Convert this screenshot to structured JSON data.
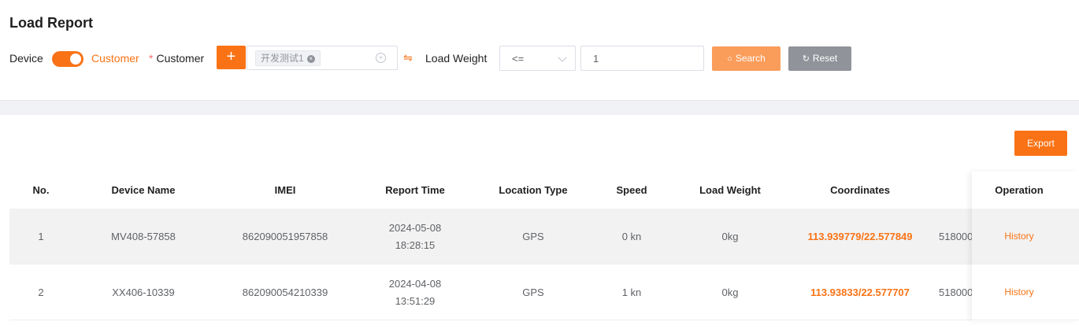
{
  "header": {
    "title": "Load Report"
  },
  "filters": {
    "device_label": "Device",
    "customer_toggle_label": "Customer",
    "customer_field_label": "Customer",
    "required_mark": "*",
    "add_symbol": "+",
    "selected_customer_tag": "开发测试1",
    "load_weight_label": "Load Weight",
    "operator_value": "<=",
    "weight_value": "1",
    "search_label": "Search",
    "reset_label": "Reset"
  },
  "toolbar": {
    "export_label": "Export"
  },
  "table": {
    "columns": [
      "No.",
      "Device Name",
      "IMEI",
      "Report Time",
      "Location Type",
      "Speed",
      "Load Weight",
      "Coordinates",
      "Operation"
    ],
    "rows": [
      {
        "no": "1",
        "device_name": "MV408-57858",
        "imei": "862090051957858",
        "date": "2024-05-08",
        "time": "18:28:15",
        "location_type": "GPS",
        "speed": "0 kn",
        "load_weight": "0kg",
        "coordinates": "113.939779/22.577849",
        "extra": "518000",
        "operation": "History"
      },
      {
        "no": "2",
        "device_name": "XX406-10339",
        "imei": "862090054210339",
        "date": "2024-04-08",
        "time": "13:51:29",
        "location_type": "GPS",
        "speed": "1 kn",
        "load_weight": "0kg",
        "coordinates": "113.93833/22.577707",
        "extra": "518000",
        "operation": "History"
      }
    ]
  },
  "colors": {
    "accent": "#f97316",
    "search_button": "#fa9d5b",
    "reset_button": "#909399"
  }
}
